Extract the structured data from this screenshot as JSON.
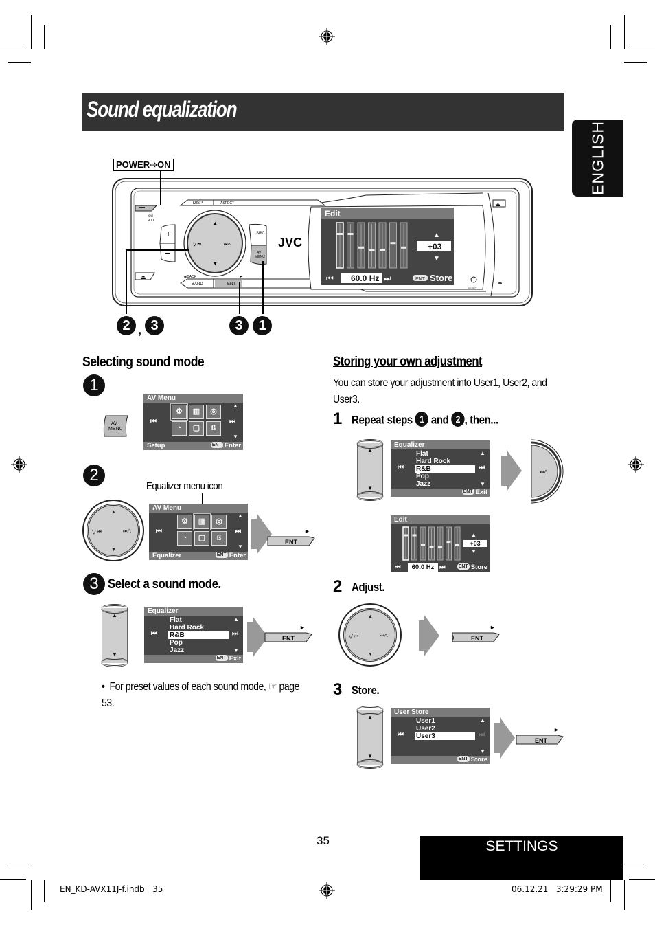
{
  "page": {
    "title": "Sound equalization",
    "language_tab": "ENGLISH",
    "section_tab": "SETTINGS",
    "page_number": "35"
  },
  "unit_diagram": {
    "power_label": "POWER⇨ON",
    "buttons": {
      "power_att": "⏻/I ATT",
      "disp": "DISP",
      "aspect": "ASPECT",
      "src": "SRC",
      "av_menu": "AV MENU",
      "back": "■/BACK",
      "band": "BAND",
      "ent": "ENT",
      "play": "►",
      "reset": "RESET",
      "brand": "JVC",
      "plus": "+",
      "minus": "−"
    },
    "screen": {
      "title": "Edit",
      "value": "+03",
      "frequency": "60.0 Hz",
      "ent_badge": "ENT",
      "store_label": "Store",
      "band_levels": [
        0.75,
        0.75,
        0.45,
        0.4,
        0.4,
        0.55,
        0.45
      ]
    },
    "callouts": [
      {
        "label": "2",
        "separator": ","
      },
      {
        "label": "3"
      },
      {
        "label": "3"
      },
      {
        "label": "1"
      }
    ]
  },
  "left_column": {
    "heading": "Selecting sound mode",
    "step1": {
      "number": "1",
      "key_label": "AV MENU",
      "screen": {
        "title": "AV Menu",
        "footer_left": "Setup",
        "ent": "ENT",
        "footer_right": "Enter"
      }
    },
    "step2": {
      "number": "2",
      "callout": "Equalizer menu icon",
      "screen": {
        "title": "AV Menu",
        "footer_left": "Equalizer",
        "ent": "ENT",
        "footer_right": "Enter"
      },
      "ent_key": "ENT"
    },
    "step3": {
      "number": "3",
      "text": "Select a sound mode.",
      "screen": {
        "title": "Equalizer",
        "items": [
          "Flat",
          "Hard Rock",
          "R&B",
          "Pop",
          "Jazz"
        ],
        "selected": "R&B",
        "ent": "ENT",
        "footer_right": "Exit"
      },
      "ent_key": "ENT"
    },
    "note": "For preset values of each sound mode, ☞ page 53."
  },
  "right_column": {
    "heading": "Storing your own adjustment",
    "intro_line1": "You can store your adjustment into User1, User2, and",
    "intro_line2": "User3.",
    "step1": {
      "number": "1",
      "text_pre": "Repeat steps",
      "ref_a": "1",
      "text_mid": "and",
      "ref_b": "2",
      "text_post": ", then...",
      "eq_screen": {
        "title": "Equalizer",
        "items": [
          "Flat",
          "Hard Rock",
          "R&B",
          "Pop",
          "Jazz"
        ],
        "selected": "R&B",
        "ent": "ENT",
        "footer_right": "Exit"
      },
      "edit_screen": {
        "title": "Edit",
        "value": "+03",
        "frequency": "60.0 Hz",
        "ent": "ENT",
        "footer_right": "Store"
      }
    },
    "step2": {
      "number": "2",
      "text": "Adjust.",
      "ent_key": "ENT"
    },
    "step3": {
      "number": "3",
      "text": "Store.",
      "screen": {
        "title": "User Store",
        "items": [
          "User1",
          "User2",
          "User3"
        ],
        "selected": "User3",
        "ent": "ENT",
        "footer_right": "Store"
      },
      "ent_key": "ENT"
    }
  },
  "footer": {
    "file_info": "EN_KD-AVX11J-f.indb   35",
    "timestamp": "06.12.21   3:29:29 PM"
  },
  "colors": {
    "title_bar": "#333333",
    "tab_bg": "#111111",
    "lcd_bg": "#444444",
    "lcd_header": "#7a7a7a",
    "dial_fill": "#cfcfcf"
  }
}
